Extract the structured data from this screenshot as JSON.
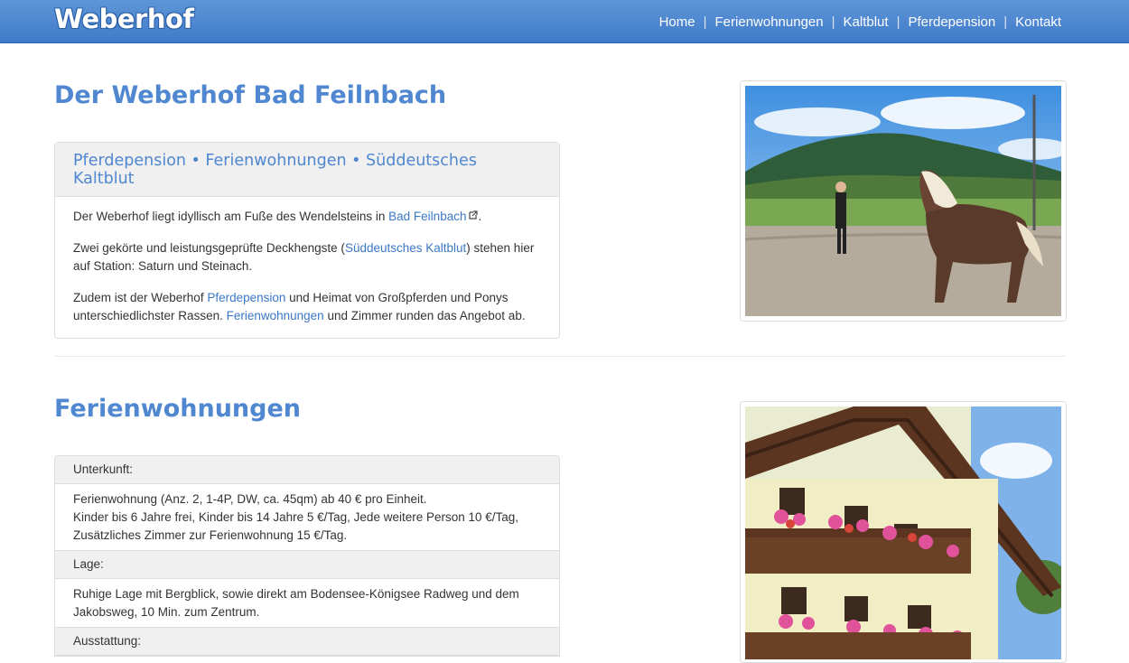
{
  "brand": "Weberhof",
  "nav": {
    "items": [
      "Home",
      "Ferienwohnungen",
      "Kaltblut",
      "Pferdepension",
      "Kontakt"
    ],
    "separator": "|"
  },
  "section1": {
    "title": "Der Weberhof Bad Feilnbach",
    "panel_heading": "Pferdepension • Ferienwohnungen • Süddeutsches Kaltblut",
    "p1": {
      "before": "Der Weberhof liegt idyllisch am Fuße des Wendelsteins in ",
      "link": "Bad Feilnbach",
      "after": "."
    },
    "p2": {
      "before": "Zwei gekörte und leistungsgeprüfte Deckhengste (",
      "link": "Süddeutsches Kaltblut",
      "after": ") stehen hier auf Station: Saturn und Steinach."
    },
    "p3": {
      "before": "Zudem ist der Weberhof ",
      "link1": "Pferdepension",
      "middle": " und Heimat von Großpferden und Ponys unterschiedlichster Rassen. ",
      "link2": "Ferienwohnungen",
      "after": " und Zimmer runden das Angebot ab."
    }
  },
  "section2": {
    "title": "Ferienwohnungen",
    "unterkunft_label": "Unterkunft:",
    "unterkunft_line1": "Ferienwohnung (Anz. 2, 1-4P, DW, ca. 45qm) ab 40 € pro Einheit.",
    "unterkunft_line2": "Kinder bis 6 Jahre frei, Kinder bis 14 Jahre 5 €/Tag, Jede weitere Person 10 €/Tag,",
    "unterkunft_line3": "Zusätzliches Zimmer zur Ferienwohnung 15 €/Tag.",
    "lage_label": "Lage:",
    "lage_text": "Ruhige Lage mit Bergblick, sowie direkt am Bodensee-Königsee Radweg und dem Jakobsweg, 10 Min. zum Zentrum.",
    "ausstattung_label": "Ausstattung:"
  },
  "colors": {
    "accent": "#4f87d1",
    "link": "#3b78c6",
    "navbar": "#4a86d0"
  }
}
